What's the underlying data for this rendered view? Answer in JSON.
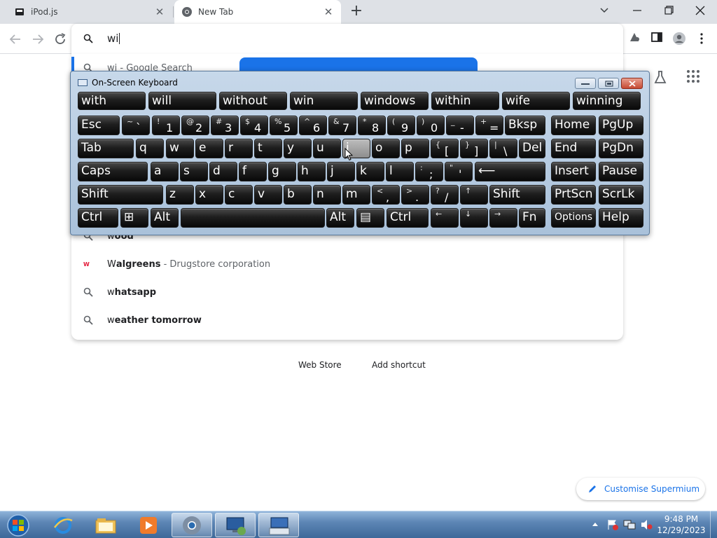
{
  "browser": {
    "tabs": [
      {
        "title": "iPod.js",
        "active": false
      },
      {
        "title": "New Tab",
        "active": true
      }
    ],
    "omnibox_text": "wi",
    "accent": "#1a73e8"
  },
  "suggestions": [
    {
      "icon": "search-icon",
      "text": "wi - Google Search"
    },
    {
      "icon": "search-icon",
      "bold_first": "w",
      "text": "ood"
    },
    {
      "icon": "walgreens-favicon",
      "bold_first": "W",
      "bold": "algreens",
      "desc": " - Drugstore corporation"
    },
    {
      "icon": "search-icon",
      "bold_first": "w",
      "bold": "hatsapp"
    },
    {
      "icon": "search-icon",
      "bold_first": "w",
      "bold": "eather tomorrow"
    }
  ],
  "ntp": {
    "shortcut_labels": [
      "Web Store",
      "Add shortcut"
    ],
    "customise_label": "Customise Supermium"
  },
  "osk": {
    "title": "On-Screen Keyboard",
    "predictions": [
      "with",
      "will",
      "without",
      "win",
      "windows",
      "within",
      "wife",
      "winning"
    ],
    "row1": [
      {
        "main": "Esc"
      },
      {
        "top": "~",
        "bot": "`"
      },
      {
        "top": "!",
        "bot": "1"
      },
      {
        "top": "@",
        "bot": "2"
      },
      {
        "top": "#",
        "bot": "3"
      },
      {
        "top": "$",
        "bot": "4"
      },
      {
        "top": "%",
        "bot": "5"
      },
      {
        "top": "^",
        "bot": "6"
      },
      {
        "top": "&",
        "bot": "7"
      },
      {
        "top": "*",
        "bot": "8"
      },
      {
        "top": "(",
        "bot": "9"
      },
      {
        "top": ")",
        "bot": "0"
      },
      {
        "top": "_",
        "bot": "-"
      },
      {
        "top": "+",
        "bot": "="
      },
      {
        "main": "Bksp"
      },
      {
        "main": "Home"
      },
      {
        "main": "PgUp"
      }
    ],
    "row2": [
      {
        "main": "Tab"
      },
      {
        "main": "q"
      },
      {
        "main": "w"
      },
      {
        "main": "e"
      },
      {
        "main": "r"
      },
      {
        "main": "t"
      },
      {
        "main": "y"
      },
      {
        "main": "u"
      },
      {
        "main": "i"
      },
      {
        "main": "o"
      },
      {
        "main": "p"
      },
      {
        "top": "{",
        "bot": "["
      },
      {
        "top": "}",
        "bot": "]"
      },
      {
        "top": "|",
        "bot": "\\"
      },
      {
        "main": "Del"
      },
      {
        "main": "End"
      },
      {
        "main": "PgDn"
      }
    ],
    "row3": [
      {
        "main": "Caps"
      },
      {
        "main": "a"
      },
      {
        "main": "s"
      },
      {
        "main": "d"
      },
      {
        "main": "f"
      },
      {
        "main": "g"
      },
      {
        "main": "h"
      },
      {
        "main": "j"
      },
      {
        "main": "k"
      },
      {
        "main": "l"
      },
      {
        "top": ":",
        "bot": ";"
      },
      {
        "top": "\"",
        "bot": "'"
      },
      {
        "main": "⟵"
      },
      {
        "main": "Insert"
      },
      {
        "main": "Pause"
      }
    ],
    "row4": [
      {
        "main": "Shift"
      },
      {
        "main": "z"
      },
      {
        "main": "x"
      },
      {
        "main": "c"
      },
      {
        "main": "v"
      },
      {
        "main": "b"
      },
      {
        "main": "n"
      },
      {
        "main": "m"
      },
      {
        "top": "<",
        "bot": ","
      },
      {
        "top": ">",
        "bot": "."
      },
      {
        "top": "?",
        "bot": "/"
      },
      {
        "top": "↑",
        "bot": ""
      },
      {
        "main": "Shift"
      },
      {
        "main": "PrtScn"
      },
      {
        "main": "ScrLk"
      }
    ],
    "row5": [
      {
        "main": "Ctrl"
      },
      {
        "main": "⊞"
      },
      {
        "main": "Alt"
      },
      {
        "main": ""
      },
      {
        "main": "Alt"
      },
      {
        "main": "▤"
      },
      {
        "main": "Ctrl"
      },
      {
        "top": "←",
        "bot": ""
      },
      {
        "top": "↓",
        "bot": ""
      },
      {
        "top": "→",
        "bot": ""
      },
      {
        "main": "Fn"
      },
      {
        "main": "Options"
      },
      {
        "main": "Help"
      }
    ],
    "highlighted_key": "i"
  },
  "taskbar": {
    "time": "9:48 PM",
    "date": "12/29/2023"
  }
}
